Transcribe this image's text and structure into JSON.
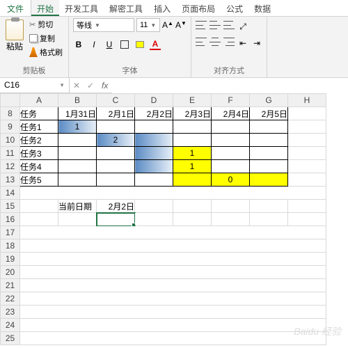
{
  "tabs": {
    "file": "文件",
    "home": "开始",
    "dev": "开发工具",
    "parse": "解密工具",
    "insert": "插入",
    "layout": "页面布局",
    "formula": "公式",
    "data": "数据"
  },
  "clipboard": {
    "paste": "粘贴",
    "cut": "剪切",
    "copy": "复制",
    "painter": "格式刷",
    "group": "剪贴板"
  },
  "font": {
    "name": "等线",
    "size": "11",
    "group": "字体",
    "grow": "A",
    "shrink": "A",
    "bold": "B",
    "italic": "I",
    "underline": "U",
    "colorA": "A"
  },
  "align": {
    "group": "对齐方式"
  },
  "namebox": "C16",
  "columns": [
    "A",
    "B",
    "C",
    "D",
    "E",
    "F",
    "G",
    "H"
  ],
  "rows": [
    "8",
    "9",
    "10",
    "11",
    "12",
    "13",
    "14",
    "15",
    "16",
    "17",
    "18",
    "19",
    "20",
    "21",
    "22",
    "23",
    "24",
    "25"
  ],
  "cells": {
    "A8": "任务",
    "B8": "1月31日",
    "C8": "2月1日",
    "D8": "2月2日",
    "E8": "2月3日",
    "F8": "2月4日",
    "G8": "2月5日",
    "A9": "任务1",
    "B9": "1",
    "A10": "任务2",
    "C10": "2",
    "A11": "任务3",
    "E11": "1",
    "A12": "任务4",
    "E12": "1",
    "A13": "任务5",
    "F13": "0",
    "B15": "当前日期",
    "C15": "2月2日"
  },
  "watermark": "Baidu 经验"
}
